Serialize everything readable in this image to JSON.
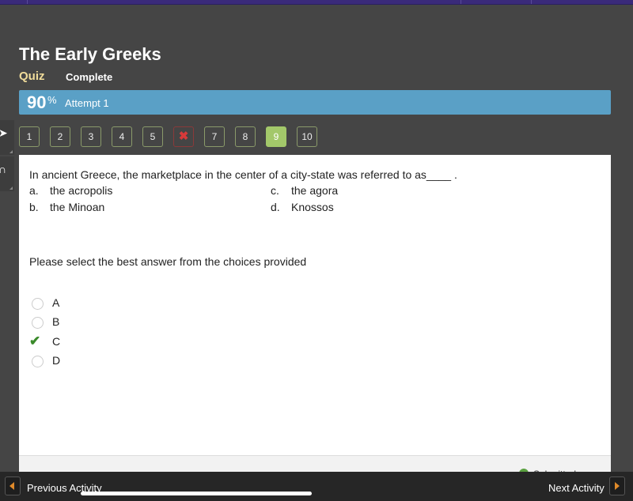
{
  "header": {
    "title": "The Early Greeks",
    "activity_type": "Quiz",
    "status": "Complete"
  },
  "score": {
    "value": "90",
    "unit": "%",
    "attempt": "Attempt 1",
    "bar_color": "#5aa0c6"
  },
  "question_nav": [
    {
      "label": "1",
      "state": "answered"
    },
    {
      "label": "2",
      "state": "answered"
    },
    {
      "label": "3",
      "state": "answered"
    },
    {
      "label": "4",
      "state": "answered"
    },
    {
      "label": "5",
      "state": "answered"
    },
    {
      "label": "✖",
      "state": "incorrect"
    },
    {
      "label": "7",
      "state": "answered"
    },
    {
      "label": "8",
      "state": "answered"
    },
    {
      "label": "9",
      "state": "current"
    },
    {
      "label": "10",
      "state": "answered"
    }
  ],
  "question": {
    "text": "In ancient Greece, the marketplace in the center of a  city-state was referred to as____ .",
    "choices": [
      {
        "letter": "a.",
        "text": "the acropolis"
      },
      {
        "letter": "b.",
        "text": "the Minoan"
      },
      {
        "letter": "c.",
        "text": "the agora"
      },
      {
        "letter": "d.",
        "text": "Knossos"
      }
    ],
    "instruction": "Please select the best answer from the choices provided"
  },
  "answer_options": [
    {
      "label": "A",
      "selected": false
    },
    {
      "label": "B",
      "selected": false
    },
    {
      "label": "C",
      "selected": true
    },
    {
      "label": "D",
      "selected": false
    }
  ],
  "footer": {
    "submitted_text": "Submitted",
    "previous_label": "Previous Activity",
    "next_label": "Next Activity"
  },
  "colors": {
    "accent_quiz": "#f0dc9a",
    "current_question": "#a3c86a",
    "incorrect": "#d83a3a",
    "correct_check": "#3a8a2a",
    "nav_arrow": "#e08a2a"
  }
}
